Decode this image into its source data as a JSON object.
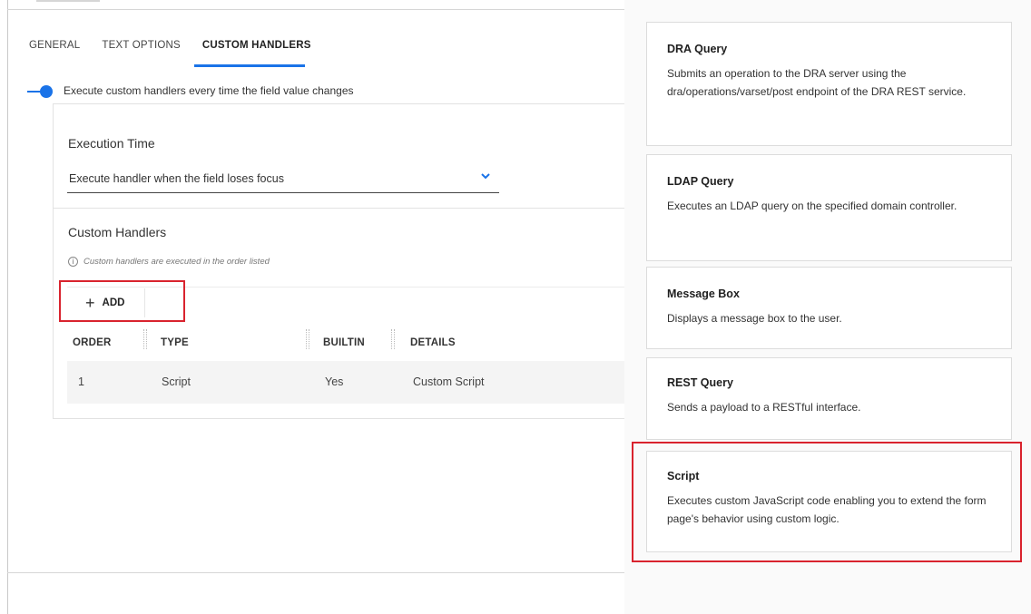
{
  "tabs": [
    {
      "label": "GENERAL",
      "active": false
    },
    {
      "label": "TEXT OPTIONS",
      "active": false
    },
    {
      "label": "CUSTOM HANDLERS",
      "active": true
    }
  ],
  "toggle": {
    "label": "Execute custom handlers every time the field value changes",
    "on": true
  },
  "execution_time": {
    "title": "Execution Time",
    "selected": "Execute handler when the field loses focus"
  },
  "custom_handlers": {
    "title": "Custom Handlers",
    "info": "Custom handlers are executed in the order listed",
    "add_label": "ADD",
    "columns": [
      "ORDER",
      "TYPE",
      "BUILTIN",
      "DETAILS"
    ],
    "rows": [
      {
        "order": "1",
        "type": "Script",
        "builtin": "Yes",
        "details": "Custom Script"
      }
    ]
  },
  "handler_types": [
    {
      "title": "DRA Query",
      "description": "Submits an operation to the DRA server using the dra/operations/varset/post endpoint of the DRA REST service."
    },
    {
      "title": "LDAP Query",
      "description": "Executes an LDAP query on the specified domain controller."
    },
    {
      "title": "Message Box",
      "description": "Displays a message box to the user."
    },
    {
      "title": "REST Query",
      "description": "Sends a payload to a RESTful interface."
    },
    {
      "title": "Script",
      "description": "Executes custom JavaScript code enabling you to extend the form page's behavior using custom logic."
    }
  ],
  "colors": {
    "accent": "#1a73e8",
    "highlight": "#d9232e"
  }
}
